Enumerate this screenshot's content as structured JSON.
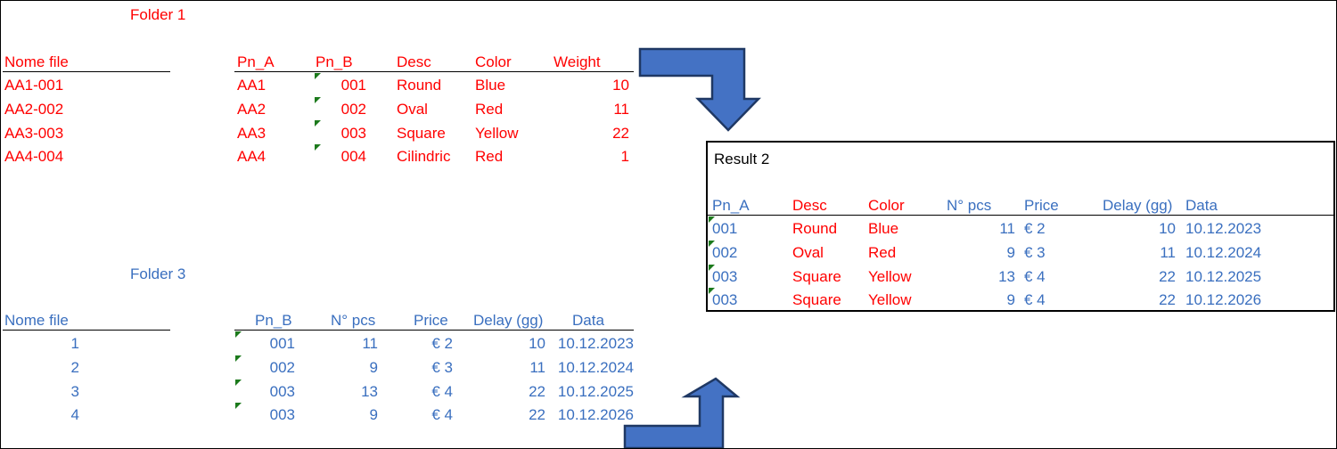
{
  "labels": {
    "folder1": "Folder 1",
    "folder3": "Folder 3",
    "result2": "Result 2"
  },
  "colors": {
    "red": "#FF0000",
    "blue": "#3A6FBF",
    "black": "#000000",
    "arrow_fill": "#4472C4",
    "arrow_stroke": "#1F3864",
    "green_flag": "#1C7A1C"
  },
  "icons": {
    "green_flag": "green-error-flag-icon",
    "arrow_down": "bent-arrow-right-down-icon",
    "arrow_up": "bent-arrow-right-up-icon"
  },
  "table_top": {
    "name_header": "Nome file",
    "name_values": [
      "AA1-001",
      "AA2-002",
      "AA3-003",
      "AA4-004"
    ],
    "headers": [
      "Pn_A",
      "Pn_B",
      "Desc",
      "Color",
      "Weight"
    ],
    "rows": [
      {
        "pn_a": "AA1",
        "pn_b": "001",
        "desc": "Round",
        "color": "Blue",
        "weight": "10"
      },
      {
        "pn_a": "AA2",
        "pn_b": "002",
        "desc": "Oval",
        "color": "Red",
        "weight": "11"
      },
      {
        "pn_a": "AA3",
        "pn_b": "003",
        "desc": "Square",
        "color": "Yellow",
        "weight": "22"
      },
      {
        "pn_a": "AA4",
        "pn_b": "004",
        "desc": "Cilindric",
        "color": "Red",
        "weight": "1"
      }
    ]
  },
  "table_bottom": {
    "name_header": "Nome file",
    "name_values": [
      "1",
      "2",
      "3",
      "4"
    ],
    "headers": [
      "Pn_B",
      "N° pcs",
      "Price",
      "Delay (gg)",
      "Data"
    ],
    "rows": [
      {
        "pn_b": "001",
        "pcs": "11",
        "price": "€ 2",
        "delay": "10",
        "data": "10.12.2023"
      },
      {
        "pn_b": "002",
        "pcs": "9",
        "price": "€ 3",
        "delay": "11",
        "data": "10.12.2024"
      },
      {
        "pn_b": "003",
        "pcs": "13",
        "price": "€ 4",
        "delay": "22",
        "data": "10.12.2025"
      },
      {
        "pn_b": "003",
        "pcs": "9",
        "price": "€ 4",
        "delay": "22",
        "data": "10.12.2026"
      }
    ]
  },
  "table_result": {
    "title": "Result 2",
    "headers": [
      "Pn_A",
      "Desc",
      "Color",
      "N° pcs",
      "Price",
      "Delay (gg)",
      "Data"
    ],
    "rows": [
      {
        "pn_a": "001",
        "desc": "Round",
        "color": "Blue",
        "pcs": "11",
        "price": "€ 2",
        "delay": "10",
        "data": "10.12.2023"
      },
      {
        "pn_a": "002",
        "desc": "Oval",
        "color": "Red",
        "pcs": "9",
        "price": "€ 3",
        "delay": "11",
        "data": "10.12.2024"
      },
      {
        "pn_a": "003",
        "desc": "Square",
        "color": "Yellow",
        "pcs": "13",
        "price": "€ 4",
        "delay": "22",
        "data": "10.12.2025"
      },
      {
        "pn_a": "003",
        "desc": "Square",
        "color": "Yellow",
        "pcs": "9",
        "price": "€ 4",
        "delay": "22",
        "data": "10.12.2026"
      }
    ]
  }
}
